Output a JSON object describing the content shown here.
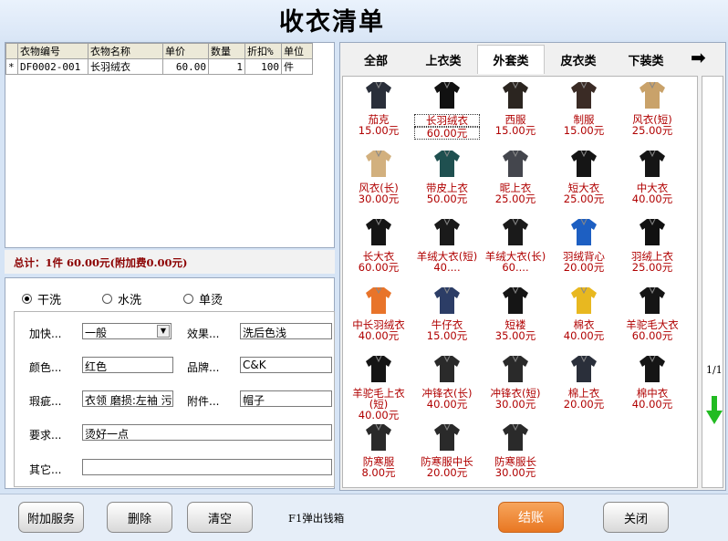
{
  "title": "收衣清单",
  "order_table": {
    "columns": [
      "",
      "衣物编号",
      "衣物名称",
      "单价",
      "数量",
      "折扣%",
      "单位"
    ],
    "rows": [
      {
        "marker": "*",
        "code": "DF0002-001",
        "name": "长羽绒衣",
        "price": "60.00",
        "qty": "1",
        "discount": "100",
        "unit": "件"
      }
    ]
  },
  "total_text": "总计：1件 60.00元(附加费0.00元)",
  "wash_options": {
    "dry": "干洗",
    "water": "水洗",
    "iron": "单烫",
    "selected": "dry"
  },
  "form": {
    "process_label": "加快...",
    "process_value": "一般",
    "effect_label": "效果...",
    "effect_value": "洗后色浅",
    "color_label": "颜色...",
    "color_value": "红色",
    "brand_label": "品牌...",
    "brand_value": "C&K",
    "flaw_label": "瑕疵...",
    "flaw_value": "衣领 磨损:左袖 污",
    "accessory_label": "附件...",
    "accessory_value": "帽子",
    "require_label": "要求...",
    "require_value": "烫好一点",
    "other_label": "其它...",
    "other_value": ""
  },
  "tabs": [
    "全部",
    "上衣类",
    "外套类",
    "皮衣类",
    "下装类"
  ],
  "active_tab": "外套类",
  "items": [
    {
      "name": "茄克",
      "price": "15.00元",
      "icon": "jacket-icon",
      "color": "#2a2f3a"
    },
    {
      "name": "长羽绒衣",
      "price": "60.00元",
      "icon": "down-coat-icon",
      "color": "#111111",
      "selected": true
    },
    {
      "name": "西服",
      "price": "15.00元",
      "icon": "suit-icon",
      "color": "#2b2520"
    },
    {
      "name": "制服",
      "price": "15.00元",
      "icon": "uniform-icon",
      "color": "#3a2b25"
    },
    {
      "name": "风衣(短)",
      "price": "25.00元",
      "icon": "trench-short-icon",
      "color": "#c9a26a"
    },
    {
      "name": "风衣(长)",
      "price": "30.00元",
      "icon": "trench-long-icon",
      "color": "#d2b07e"
    },
    {
      "name": "带皮上衣",
      "price": "50.00元",
      "icon": "leather-top-icon",
      "color": "#1f5050"
    },
    {
      "name": "昵上衣",
      "price": "25.00元",
      "icon": "wool-top-icon",
      "color": "#44464d"
    },
    {
      "name": "短大衣",
      "price": "25.00元",
      "icon": "short-overcoat-icon",
      "color": "#151515"
    },
    {
      "name": "中大衣",
      "price": "40.00元",
      "icon": "mid-overcoat-icon",
      "color": "#151515"
    },
    {
      "name": "长大衣",
      "price": "60.00元",
      "icon": "long-overcoat-icon",
      "color": "#151515"
    },
    {
      "name": "羊绒大衣(短)40....",
      "price": "",
      "icon": "cashmere-short-icon",
      "color": "#1a1a1a"
    },
    {
      "name": "羊绒大衣(长)60....",
      "price": "",
      "icon": "cashmere-long-icon",
      "color": "#1a1a1a"
    },
    {
      "name": "羽绒背心",
      "price": "20.00元",
      "icon": "down-vest-icon",
      "color": "#1d5fc2"
    },
    {
      "name": "羽绒上衣",
      "price": "25.00元",
      "icon": "down-top-icon",
      "color": "#111111"
    },
    {
      "name": "中长羽绒衣",
      "price": "40.00元",
      "icon": "mid-down-coat-icon",
      "color": "#e8742a"
    },
    {
      "name": "牛仔衣",
      "price": "15.00元",
      "icon": "denim-jacket-icon",
      "color": "#2c3d66"
    },
    {
      "name": "短褛",
      "price": "35.00元",
      "icon": "short-coat-icon",
      "color": "#151515"
    },
    {
      "name": "棉衣",
      "price": "40.00元",
      "icon": "cotton-coat-icon",
      "color": "#e8b820"
    },
    {
      "name": "羊驼毛大衣",
      "price": "60.00元",
      "icon": "alpaca-coat-icon",
      "color": "#151515"
    },
    {
      "name": "羊驼毛上衣(短)",
      "price": "40.00元",
      "icon": "alpaca-top-icon",
      "color": "#151515"
    },
    {
      "name": "冲锋衣(长)",
      "price": "40.00元",
      "icon": "outdoor-long-icon",
      "color": "#2a2a2a"
    },
    {
      "name": "冲锋衣(短)",
      "price": "30.00元",
      "icon": "outdoor-short-icon",
      "color": "#2a2a2a"
    },
    {
      "name": "棉上衣",
      "price": "20.00元",
      "icon": "cotton-top-icon",
      "color": "#2a2f3a"
    },
    {
      "name": "棉中衣",
      "price": "40.00元",
      "icon": "cotton-mid-icon",
      "color": "#151515"
    },
    {
      "name": "防寒服",
      "price": "8.00元",
      "icon": "winter-coat-icon",
      "color": "#2a2a2a"
    },
    {
      "name": "防寒服中长",
      "price": "20.00元",
      "icon": "winter-mid-icon",
      "color": "#2a2a2a"
    },
    {
      "name": "防寒服长",
      "price": "30.00元",
      "icon": "winter-long-icon",
      "color": "#2a2a2a"
    }
  ],
  "page_indicator": "1/1",
  "buttons": {
    "extra": "附加服务",
    "delete": "删除",
    "clear": "清空",
    "checkout": "结账",
    "close": "关闭"
  },
  "hint": "F1弹出钱箱",
  "colors": {
    "item_text": "#b00000",
    "checkout": "#e87722",
    "arrow": "#22bb22"
  }
}
